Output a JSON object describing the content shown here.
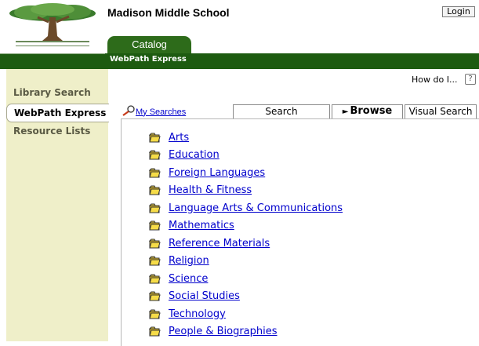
{
  "header": {
    "school_name": "Madison Middle School",
    "login_label": "Login",
    "catalog_tab": "Catalog",
    "subtitle": "WebPath Express"
  },
  "sidebar": {
    "items": [
      {
        "label": "Library Search",
        "active": false
      },
      {
        "label": "WebPath Express",
        "active": true
      },
      {
        "label": "Resource Lists",
        "active": false
      }
    ]
  },
  "help": {
    "label": "How do I...",
    "button": "?"
  },
  "my_searches": "My Searches",
  "tabs": {
    "search": "Search",
    "browse": "Browse",
    "visual": "Visual Search"
  },
  "topics": [
    "Arts",
    "Education",
    "Foreign Languages",
    "Health & Fitness",
    "Language Arts & Communications",
    "Mathematics",
    "Reference Materials",
    "Religion",
    "Science",
    "Social Studies",
    "Technology",
    "People & Biographies"
  ],
  "colors": {
    "green_dark": "#1d5b10",
    "green_tab": "#2d6b1a",
    "sidebar_bg": "#efefc9",
    "link": "#0000cc"
  }
}
